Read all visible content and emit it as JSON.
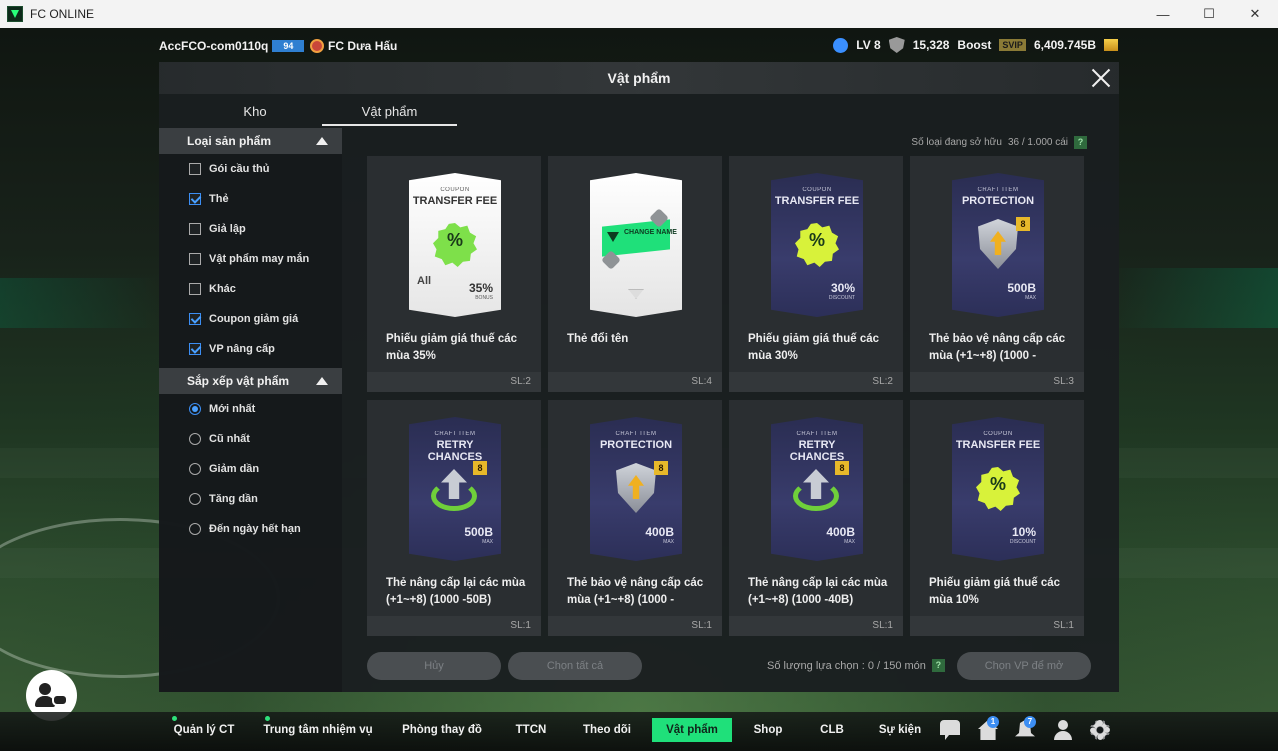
{
  "window": {
    "title": "FC ONLINE",
    "minimize": "—",
    "maximize": "☐",
    "close": "✕"
  },
  "hud": {
    "account": "AccFCO-com0110q",
    "account_badge": "94",
    "club": "FC Dưa Hấu",
    "level": "LV 8",
    "points": "15,328",
    "boost": "Boost",
    "svip": "SVIP",
    "balance": "6,409.745B"
  },
  "modal": {
    "title": "Vật phẩm",
    "tabs": [
      "Kho",
      "Vật phẩm"
    ],
    "owned_label": "Số loại đang sở hữu",
    "owned_value": "36 / 1.000 cái",
    "help": "?"
  },
  "sidebar": {
    "filter_title": "Loại sản phẩm",
    "filters": [
      {
        "label": "Gói cầu thủ",
        "checked": false
      },
      {
        "label": "Thẻ",
        "checked": true
      },
      {
        "label": "Giả lập",
        "checked": false
      },
      {
        "label": "Vật phẩm may mắn",
        "checked": false
      },
      {
        "label": "Khác",
        "checked": false
      },
      {
        "label": "Coupon giảm giá",
        "checked": true
      },
      {
        "label": "VP nâng cấp",
        "checked": true
      }
    ],
    "sort_title": "Sắp xếp vật phẩm",
    "sorts": [
      {
        "label": "Mới nhất",
        "selected": true
      },
      {
        "label": "Cũ nhất",
        "selected": false
      },
      {
        "label": "Giảm dần",
        "selected": false
      },
      {
        "label": "Tăng dần",
        "selected": false
      },
      {
        "label": "Đến ngày hết hạn",
        "selected": false
      }
    ]
  },
  "items": [
    {
      "name": "Phiếu giảm giá thuế các mùa 35%",
      "qty": "SL:2",
      "kind": "coupon-white",
      "top": "COUPON",
      "head": "TRANSFER FEE",
      "pct": "35%",
      "sub": "BONUS",
      "extra": "All",
      "badge": "%"
    },
    {
      "name": "Thẻ đổi tên",
      "qty": "SL:4",
      "kind": "changename",
      "card_text": "CHANGE NAME"
    },
    {
      "name": "Phiếu giảm giá thuế các mùa 30%",
      "qty": "SL:2",
      "kind": "coupon-dark",
      "top": "COUPON",
      "head": "TRANSFER FEE",
      "pct": "30%",
      "sub": "DISCOUNT",
      "badge": "%"
    },
    {
      "name": "Thẻ bảo vệ nâng cấp các mùa (+1~+8) (1000 -",
      "qty": "SL:3",
      "kind": "protection",
      "top": "CRAFT ITEM",
      "head": "PROTECTION",
      "pct": "500B",
      "sub": "MAX",
      "lvl": "8"
    },
    {
      "name": "Thẻ nâng cấp lại các mùa (+1~+8) (1000 -50B)",
      "qty": "SL:1",
      "kind": "retry",
      "top": "CRAFT ITEM",
      "head": "RETRY CHANCES",
      "pct": "500B",
      "sub": "MAX",
      "lvl": "8"
    },
    {
      "name": "Thẻ bảo vệ nâng cấp các mùa (+1~+8) (1000 -",
      "qty": "SL:1",
      "kind": "protection",
      "top": "CRAFT ITEM",
      "head": "PROTECTION",
      "pct": "400B",
      "sub": "MAX",
      "lvl": "8"
    },
    {
      "name": "Thẻ nâng cấp lại các mùa (+1~+8) (1000 -40B)",
      "qty": "SL:1",
      "kind": "retry",
      "top": "CRAFT ITEM",
      "head": "RETRY CHANCES",
      "pct": "400B",
      "sub": "MAX",
      "lvl": "8"
    },
    {
      "name": "Phiếu giảm giá thuế các mùa 10%",
      "qty": "SL:1",
      "kind": "coupon-dark",
      "top": "COUPON",
      "head": "TRANSFER FEE",
      "pct": "10%",
      "sub": "DISCOUNT",
      "badge": "%"
    }
  ],
  "actions": {
    "cancel": "Hủy",
    "select_all": "Chọn tất cả",
    "selected_label": "Số lượng lựa chọn : 0 / 150 món",
    "open": "Chọn VP để mở"
  },
  "nav": {
    "items": [
      "Quản lý CT",
      "Trung tâm nhiệm vụ",
      "Phòng thay đồ",
      "TTCN",
      "Theo dõi",
      "Vật phẩm",
      "Shop",
      "CLB",
      "Sự kiện"
    ],
    "active": "Vật phẩm",
    "home_badge": "1",
    "bell_badge": "7"
  },
  "colors": {
    "accent": "#1fe07a",
    "check": "#4aa0ff"
  }
}
